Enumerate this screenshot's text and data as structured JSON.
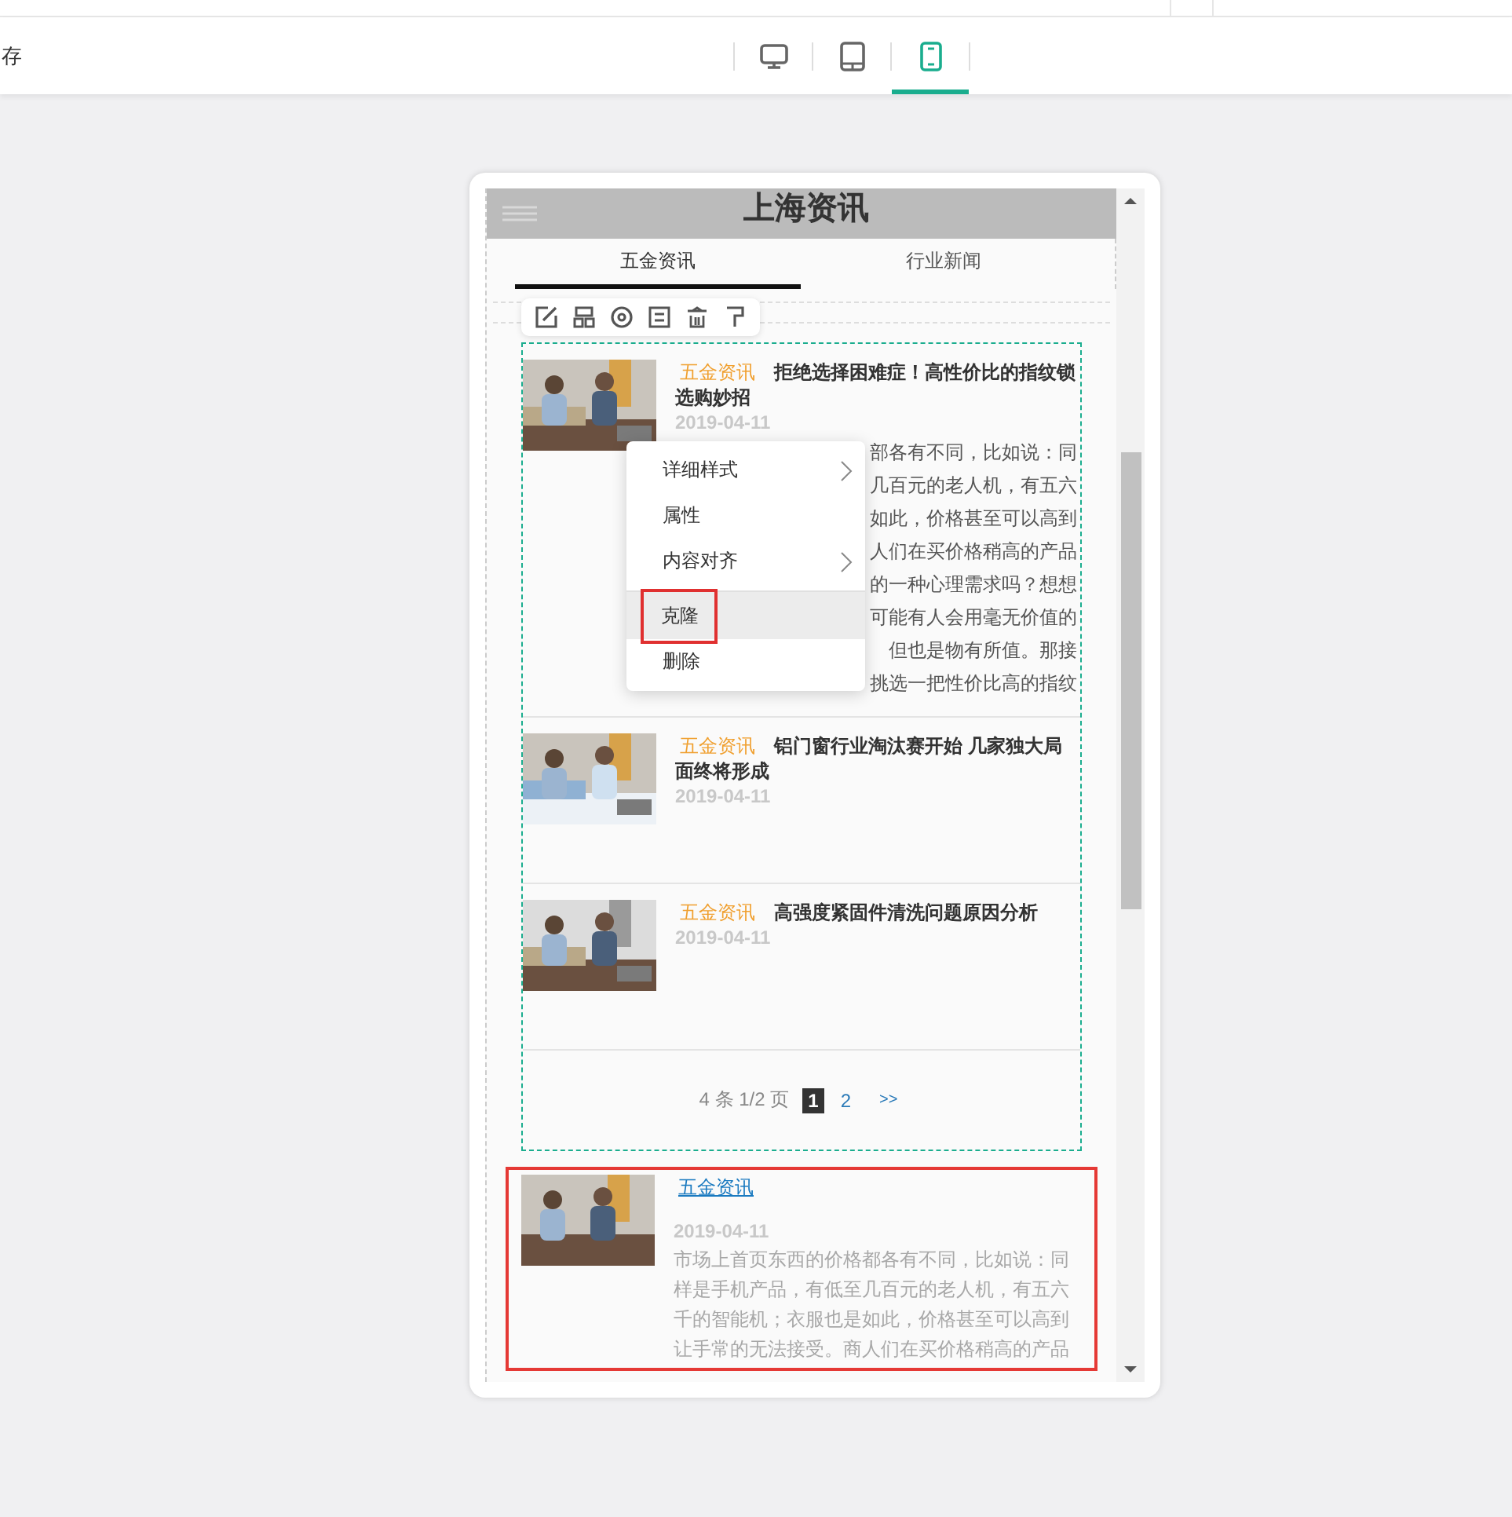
{
  "top_bar": {
    "save_label": "存",
    "devices": [
      {
        "kind": "desktop",
        "selected": false
      },
      {
        "kind": "tablet",
        "selected": false
      },
      {
        "kind": "phone",
        "selected": true
      }
    ]
  },
  "preview": {
    "header_title": "上海资讯",
    "tabs": [
      {
        "label": "五金资讯",
        "selected": true
      },
      {
        "label": "行业新闻",
        "selected": false
      }
    ],
    "news": [
      {
        "category": "五金资讯",
        "title": "拒绝选择困难症！高性价比的指纹锁选购妙招",
        "date": "2019-04-11",
        "picture": {
          "kind": "picture"
        },
        "excerpt_lines": [
          "部各有不同，比如说：同",
          "几百元的老人机，有五六",
          "如此，价格甚至可以高到",
          "人们在买价格稍高的产品",
          "的一种心理需求吗？想想",
          "可能有人会用毫无价值的",
          "但也是物有所值。那接",
          "挑选一把性价比高的指纹"
        ]
      },
      {
        "category": "五金资讯",
        "title": "铝门窗行业淘汰赛开始 几家独大局面终将形成",
        "date": "2019-04-11",
        "picture": {
          "kind": "picture"
        }
      },
      {
        "category": "五金资讯",
        "title": "高强度紧固件清洗问题原因分析",
        "date": "2019-04-11",
        "picture": {
          "kind": "picture"
        }
      }
    ],
    "pagination": {
      "summary": "4 条 1/2 页",
      "pages": [
        {
          "label": "1",
          "selected": true
        },
        {
          "label": "2",
          "selected": false
        }
      ],
      "next": ">>"
    },
    "context_menu": [
      {
        "label": "详细样式",
        "submenu": true,
        "divider_before": false,
        "selected": false
      },
      {
        "label": "属性",
        "submenu": false,
        "divider_before": false,
        "selected": false
      },
      {
        "label": "内容对齐",
        "submenu": true,
        "divider_before": false,
        "selected": false
      },
      {
        "label": "克隆",
        "submenu": false,
        "divider_before": true,
        "selected": true
      },
      {
        "label": "删除",
        "submenu": false,
        "divider_before": false,
        "selected": false
      }
    ],
    "clone": {
      "category": "五金资讯",
      "date": "2019-04-11",
      "picture": {
        "kind": "picture"
      },
      "excerpt_lines": [
        "市场上首页东西的价格都各有不同，比如说：同",
        "样是手机产品，有低至几百元的老人机，有五六",
        "千的智能机；衣服也是如此，价格甚至可以高到",
        "让手常的无法接受。商人们在买价格稍高的产品"
      ]
    }
  }
}
